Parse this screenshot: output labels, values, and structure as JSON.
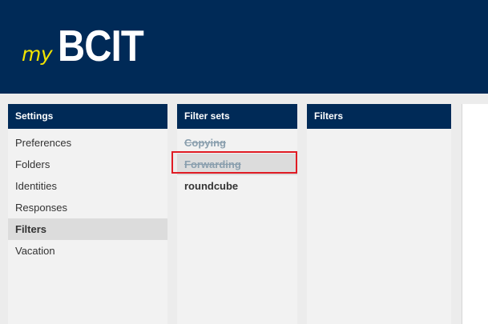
{
  "header": {
    "logo_prefix": "my",
    "logo_brand": "BCIT"
  },
  "settings_panel": {
    "title": "Settings",
    "items": [
      {
        "label": "Preferences"
      },
      {
        "label": "Folders"
      },
      {
        "label": "Identities"
      },
      {
        "label": "Responses"
      },
      {
        "label": "Filters",
        "selected": true
      },
      {
        "label": "Vacation"
      }
    ]
  },
  "filter_sets_panel": {
    "title": "Filter sets",
    "items": [
      {
        "label": "Copying",
        "state": "disabled"
      },
      {
        "label": "Forwarding",
        "state": "disabled",
        "highlighted": true
      },
      {
        "label": "roundcube",
        "state": "active"
      }
    ]
  },
  "filters_panel": {
    "title": "Filters",
    "items": []
  },
  "colors": {
    "header_bg": "#002a57",
    "logo_accent": "#f2e400",
    "panel_bg": "#f2f2f2",
    "selected_bg": "#dcdcdc",
    "disabled_text": "#8a9fae",
    "annotation_red": "#e01b24"
  }
}
